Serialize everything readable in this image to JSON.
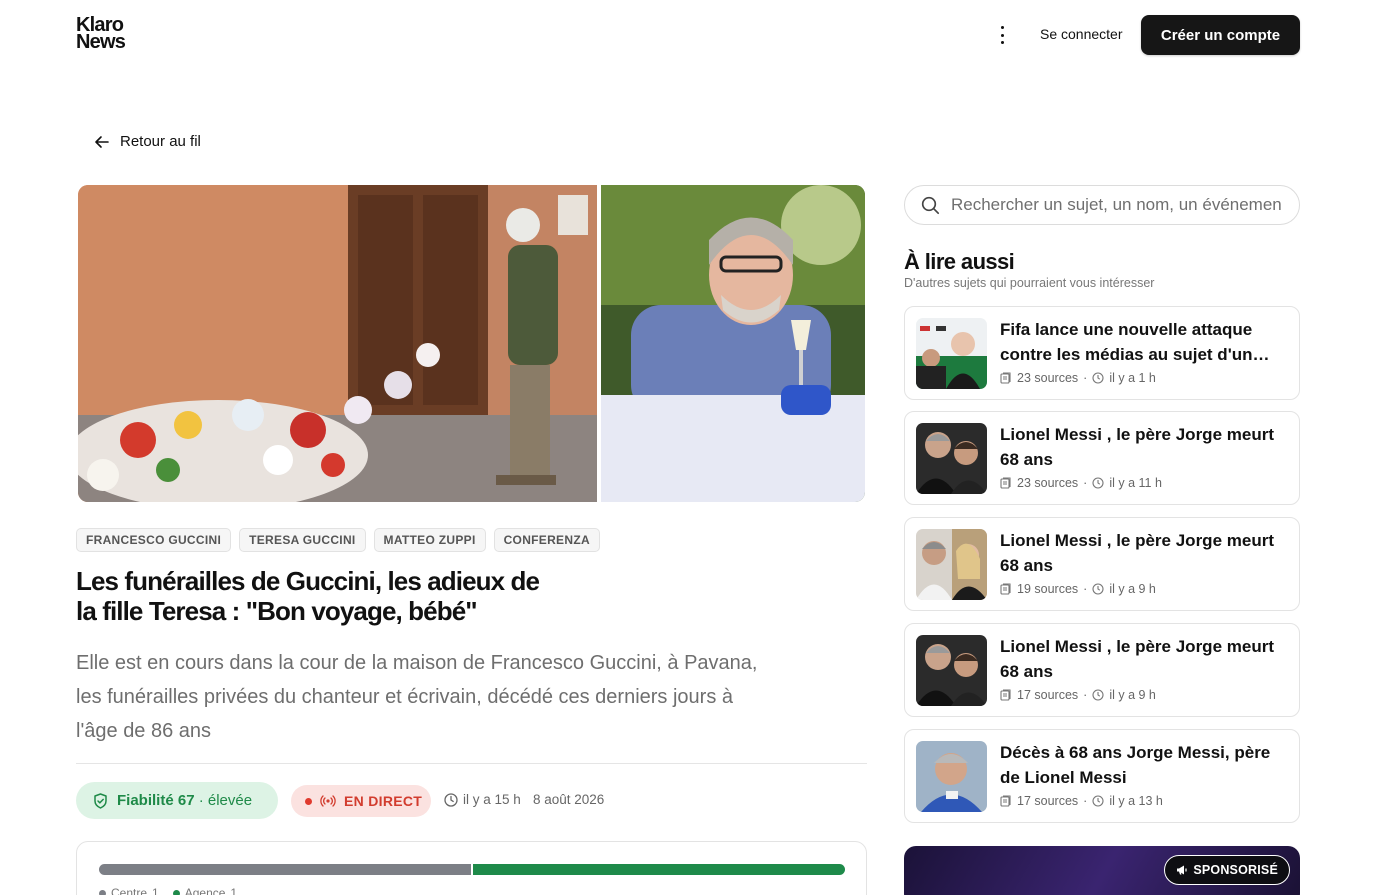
{
  "brand": {
    "line1": "Klaro",
    "line2": "News"
  },
  "header": {
    "login_label": "Se connecter",
    "signup_label": "Créer un compte"
  },
  "back_label": "Retour au fil",
  "article": {
    "tags": [
      "FRANCESCO GUCCINI",
      "TERESA GUCCINI",
      "MATTEO ZUPPI",
      "CONFERENZA"
    ],
    "title": "Les funérailles de Guccini, les adieux de la fille Teresa : \"Bon voyage, bébé\"",
    "lead": "Elle est en cours dans la cour de la maison de Francesco Guccini, à Pavana, les funérailles privées du chanteur et écrivain, décédé ces derniers jours à l'âge de 86 ans",
    "reliability": {
      "label": "Fiabilité",
      "score": "67",
      "level": "· élevée"
    },
    "live_label": "EN DIRECT",
    "time_ago": "il y a 15 h",
    "date": "8 août 2026",
    "coverage": {
      "shares": [
        0.5,
        0.5
      ],
      "legend": [
        {
          "label": "Centre",
          "count": "1"
        },
        {
          "label": "Agence",
          "count": "1"
        }
      ]
    }
  },
  "sidebar": {
    "search_placeholder": "Rechercher un sujet, un nom, un événement",
    "heading": "À lire aussi",
    "subheading": "D'autres sujets qui pourraient vous intéresser",
    "cards": [
      {
        "title": "Fifa lance une nouvelle attaque contre les médias au sujet d'un montant",
        "sources": "23 sources",
        "time": "il y a 1 h"
      },
      {
        "title": "Lionel Messi , le père Jorge meurt 68 ans",
        "sources": "23 sources",
        "time": "il y a 11 h"
      },
      {
        "title": "Lionel Messi , le père Jorge meurt 68 ans",
        "sources": "19 sources",
        "time": "il y a 9 h"
      },
      {
        "title": "Lionel Messi , le père Jorge meurt 68 ans",
        "sources": "17 sources",
        "time": "il y a 9 h"
      },
      {
        "title": "Décès à 68 ans Jorge Messi, père de Lionel Messi",
        "sources": "17 sources",
        "time": "il y a 13 h"
      }
    ],
    "sponsored_label": "SPONSORISÉ"
  },
  "colors": {
    "accent_green": "#1e8a48",
    "live_red": "#d23c2e",
    "button_dark": "#161616"
  }
}
